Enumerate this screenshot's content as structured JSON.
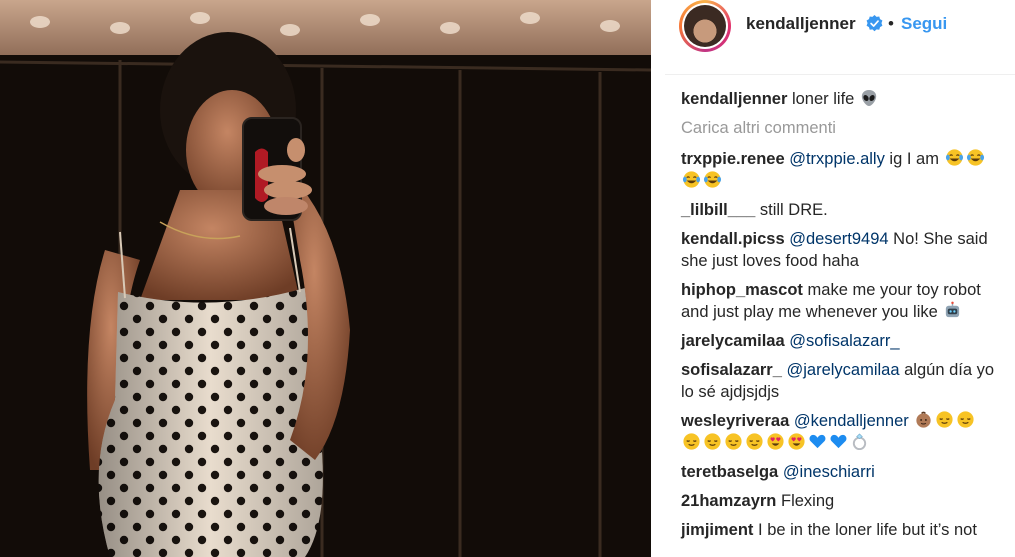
{
  "header": {
    "username": "kendalljenner",
    "separator": "•",
    "follow_label": "Segui"
  },
  "caption": {
    "username": "kendalljenner",
    "text": "loner life",
    "emoji": "alien-icon"
  },
  "load_more_label": "Carica altri commenti",
  "comments": [
    {
      "username": "trxppie.renee",
      "mention": "@trxppie.ally",
      "text": " ig I am",
      "emojis": [
        "tears-of-joy-icon",
        "tears-of-joy-icon",
        "tears-of-joy-icon",
        "tears-of-joy-icon"
      ]
    },
    {
      "username": "_lilbill___",
      "mention": "",
      "text": "still DRE.",
      "emojis": []
    },
    {
      "username": "kendall.picss",
      "mention": "@desert9494",
      "text": " No! She said she just loves food haha",
      "emojis": []
    },
    {
      "username": "hiphop_mascot",
      "mention": "",
      "text": "make me your toy robot and just play me whenever you like",
      "emojis": [
        "robot-icon"
      ]
    },
    {
      "username": "jarelycamilaa",
      "mention": "@sofisalazarr_",
      "text": "",
      "emojis": []
    },
    {
      "username": "sofisalazarr_",
      "mention": "@jarelycamilaa",
      "text": " algún día yo lo sé ajdjsjdjs",
      "emojis": []
    },
    {
      "username": "wesleyriveraa",
      "mention": "@kendalljenner",
      "text": "",
      "emojis": [
        "baby-icon",
        "relieved-icon",
        "relieved-icon",
        "relieved-icon",
        "relieved-icon",
        "relieved-icon",
        "relieved-icon",
        "heart-eyes-icon",
        "heart-eyes-icon",
        "blue-heart-icon",
        "blue-heart-icon",
        "ring-icon"
      ]
    },
    {
      "username": "teretbaselga",
      "mention": "@ineschiarri",
      "text": "",
      "emojis": []
    },
    {
      "username": "21hamzayrn",
      "mention": "",
      "text": "Flexing",
      "emojis": []
    },
    {
      "username": "jimjiment",
      "mention": "",
      "text": "I be in the loner life but it’s not",
      "emojis": []
    }
  ],
  "colors": {
    "accent": "#3897f0",
    "mention": "#003569",
    "muted": "#999999",
    "text": "#262626"
  }
}
